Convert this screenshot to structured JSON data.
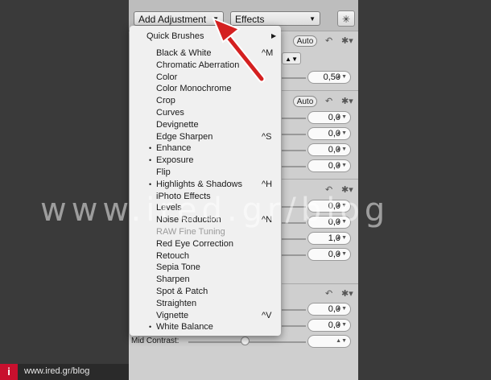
{
  "toolbar": {
    "add_adjustment_label": "Add Adjustment",
    "effects_label": "Effects"
  },
  "menu": {
    "quick_brushes": "Quick Brushes",
    "items": [
      {
        "label": "Black & White",
        "shortcut": "^M",
        "dot": false,
        "disabled": false
      },
      {
        "label": "Chromatic Aberration",
        "shortcut": "",
        "dot": false,
        "disabled": false
      },
      {
        "label": "Color",
        "shortcut": "",
        "dot": false,
        "disabled": false
      },
      {
        "label": "Color Monochrome",
        "shortcut": "",
        "dot": false,
        "disabled": false
      },
      {
        "label": "Crop",
        "shortcut": "",
        "dot": false,
        "disabled": false
      },
      {
        "label": "Curves",
        "shortcut": "",
        "dot": false,
        "disabled": false
      },
      {
        "label": "Devignette",
        "shortcut": "",
        "dot": false,
        "disabled": false
      },
      {
        "label": "Edge Sharpen",
        "shortcut": "^S",
        "dot": false,
        "disabled": false
      },
      {
        "label": "Enhance",
        "shortcut": "",
        "dot": true,
        "disabled": false
      },
      {
        "label": "Exposure",
        "shortcut": "",
        "dot": true,
        "disabled": false
      },
      {
        "label": "Flip",
        "shortcut": "",
        "dot": false,
        "disabled": false
      },
      {
        "label": "Highlights & Shadows",
        "shortcut": "^H",
        "dot": true,
        "disabled": false
      },
      {
        "label": "iPhoto Effects",
        "shortcut": "",
        "dot": false,
        "disabled": false
      },
      {
        "label": "Levels",
        "shortcut": "",
        "dot": false,
        "disabled": false
      },
      {
        "label": "Noise Reduction",
        "shortcut": "^N",
        "dot": false,
        "disabled": false
      },
      {
        "label": "RAW Fine Tuning",
        "shortcut": "",
        "dot": false,
        "disabled": true
      },
      {
        "label": "Red Eye Correction",
        "shortcut": "",
        "dot": false,
        "disabled": false
      },
      {
        "label": "Retouch",
        "shortcut": "",
        "dot": false,
        "disabled": false
      },
      {
        "label": "Sepia Tone",
        "shortcut": "",
        "dot": false,
        "disabled": false
      },
      {
        "label": "Sharpen",
        "shortcut": "",
        "dot": false,
        "disabled": false
      },
      {
        "label": "Spot & Patch",
        "shortcut": "",
        "dot": false,
        "disabled": false
      },
      {
        "label": "Straighten",
        "shortcut": "",
        "dot": false,
        "disabled": false
      },
      {
        "label": "Vignette",
        "shortcut": "^V",
        "dot": false,
        "disabled": false
      },
      {
        "label": "White Balance",
        "shortcut": "",
        "dot": true,
        "disabled": false
      }
    ]
  },
  "panel": {
    "auto_label": "Auto",
    "values": [
      "0,50",
      "0,0",
      "0,0",
      "0,0",
      "0,0",
      "0,0",
      "0,0",
      "1,0",
      "0,0",
      "0,0",
      "0,0"
    ],
    "mid_contrast_label": "Mid Contrast:"
  },
  "watermark": "www.ired.gr/blog",
  "footer": {
    "logo": "i",
    "text": "www.ired.gr/blog"
  },
  "colors": {
    "arrow": "#d42020",
    "logo_bg": "#c8102e"
  }
}
